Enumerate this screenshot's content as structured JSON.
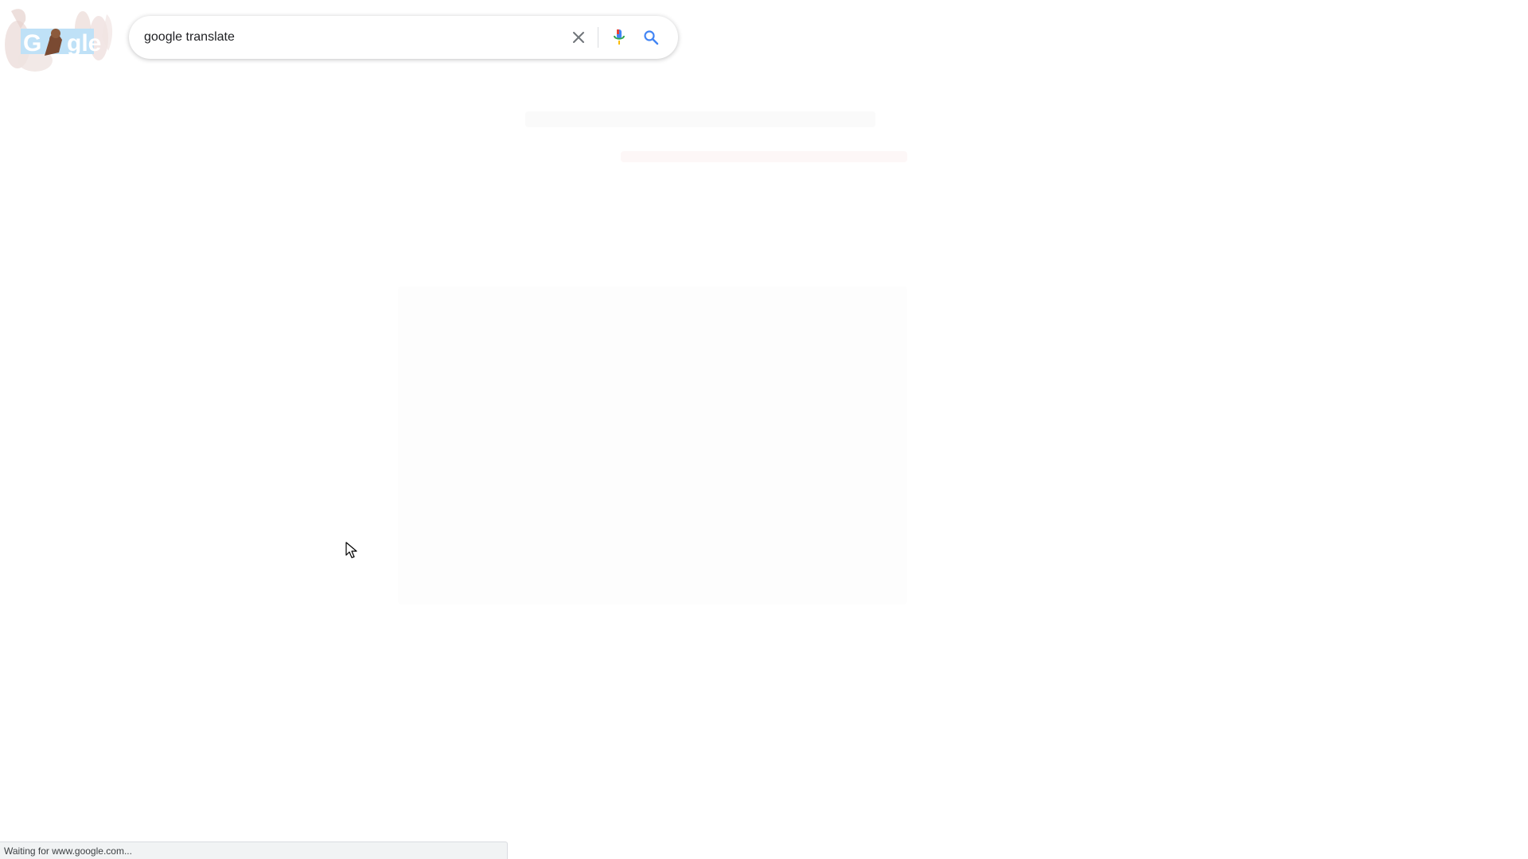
{
  "search": {
    "value": "google translate",
    "placeholder": ""
  },
  "icons": {
    "logo": "google-doodle-logo",
    "clear": "close-icon",
    "voice": "microphone-icon",
    "search": "search-icon"
  },
  "colors": {
    "blue": "#4285f4",
    "red": "#ea4335",
    "yellow": "#fbbc04",
    "green": "#34a853",
    "clear_icon": "#70757a",
    "search_icon": "#4285f4"
  },
  "status_bar": {
    "text": "Waiting for www.google.com..."
  }
}
